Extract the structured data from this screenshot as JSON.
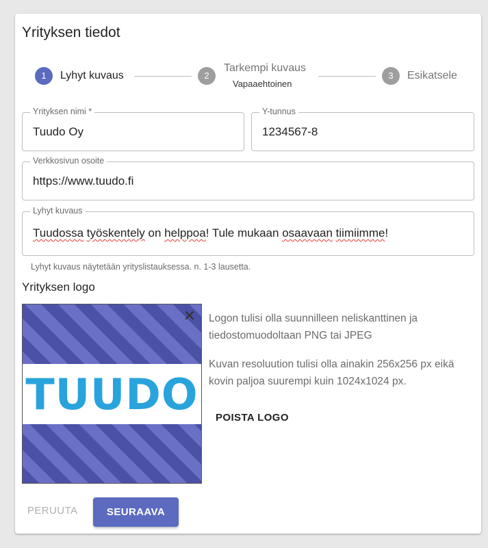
{
  "title": "Yrityksen tiedot",
  "stepper": {
    "steps": [
      {
        "number": "1",
        "label": "Lyhyt kuvaus",
        "sub": "",
        "active": true
      },
      {
        "number": "2",
        "label": "Tarkempi kuvaus",
        "sub": "Vapaaehtoinen",
        "active": false
      },
      {
        "number": "3",
        "label": "Esikatsele",
        "sub": "",
        "active": false
      }
    ]
  },
  "form": {
    "company_name": {
      "label": "Yrityksen nimi *",
      "value": "Tuudo Oy"
    },
    "business_id": {
      "label": "Y-tunnus",
      "value": "1234567-8"
    },
    "website": {
      "label": "Verkkosivun osoite",
      "value": "https://www.tuudo.fi"
    },
    "short_description": {
      "label": "Lyhyt kuvaus",
      "value_parts": [
        "Tuudossa",
        " ",
        "työskentely",
        " on ",
        "helppoa",
        "! Tule mukaan ",
        "osaavaan",
        " ",
        "tiimiimme",
        "!"
      ],
      "helper": "Lyhyt kuvaus näytetään yrityslistauksessa. n. 1-3 lausetta."
    }
  },
  "logo": {
    "heading": "Yrityksen logo",
    "logo_text": "TUUDO",
    "close_symbol": "✕",
    "desc_1": "Logon tulisi olla suunnilleen neliskanttinen ja tiedostomuodoltaan PNG tai JPEG",
    "desc_2": "Kuvan resoluution tulisi olla ainakin 256x256 px eikä kovin paljoa suurempi kuin 1024x1024 px.",
    "remove_label": "POISTA LOGO"
  },
  "actions": {
    "cancel_label": "PERUUTA",
    "next_label": "SEURAAVA"
  },
  "colors": {
    "accent": "#5c6bc0",
    "inactive_step": "#9e9e9e",
    "logo_blue": "#29a3dc",
    "stripe_dark": "#4a51a6",
    "stripe_light": "#6a70c6",
    "spellcheck": "#e53935"
  }
}
